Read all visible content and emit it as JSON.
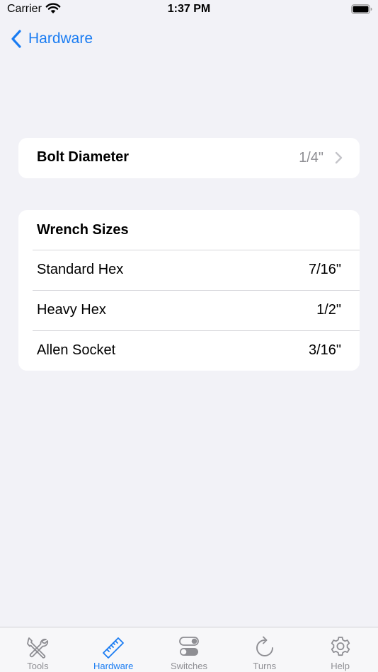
{
  "status_bar": {
    "carrier": "Carrier",
    "time": "1:37 PM",
    "icons": [
      "wifi-icon",
      "battery-icon"
    ]
  },
  "nav": {
    "back_label": "Hardware",
    "back_icon": "chevron-left-icon"
  },
  "bolt": {
    "label": "Bolt Diameter",
    "value": "1/4\"",
    "icon": "chevron-right-icon"
  },
  "wrench": {
    "header": "Wrench Sizes",
    "rows": [
      {
        "name": "Standard Hex",
        "size": "7/16\""
      },
      {
        "name": "Heavy Hex",
        "size": "1/2\""
      },
      {
        "name": "Allen Socket",
        "size": "3/16\""
      }
    ]
  },
  "tabs": [
    {
      "label": "Tools",
      "icon": "tools-icon",
      "active": false
    },
    {
      "label": "Hardware",
      "icon": "ruler-icon",
      "active": true
    },
    {
      "label": "Switches",
      "icon": "switches-icon",
      "active": false
    },
    {
      "label": "Turns",
      "icon": "rotate-icon",
      "active": false
    },
    {
      "label": "Help",
      "icon": "gear-icon",
      "active": false
    }
  ],
  "colors": {
    "accent": "#1a7cf2",
    "background": "#f2f2f7",
    "secondary_text": "#8e8e93",
    "inactive_icon": "#8e8e93"
  }
}
